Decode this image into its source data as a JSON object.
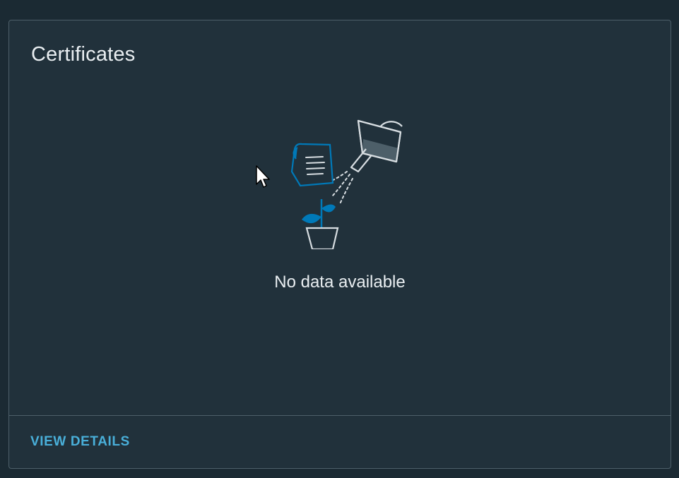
{
  "card": {
    "title": "Certificates",
    "empty_message": "No data available",
    "footer_link": "VIEW DETAILS"
  },
  "illustration": {
    "icon": "watering-can-plant-icon"
  },
  "colors": {
    "page_background": "#1b2a33",
    "card_background": "#21313b",
    "border": "#4d5f69",
    "text": "#e9eef1",
    "link": "#49afd9",
    "illustration_accent": "#0079b8"
  }
}
